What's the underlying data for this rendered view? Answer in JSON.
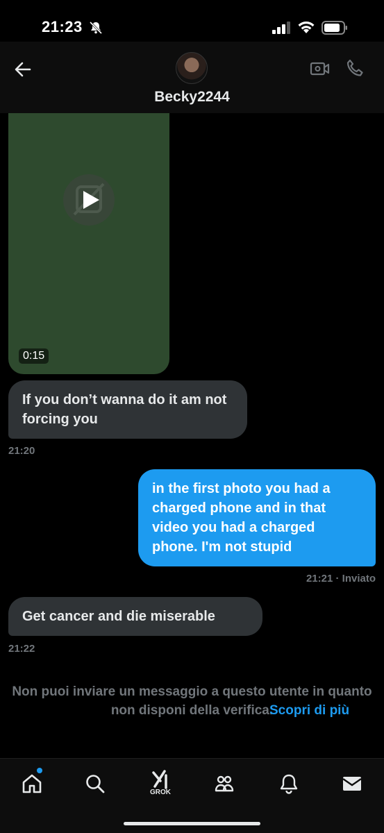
{
  "status_bar": {
    "time": "21:23"
  },
  "header": {
    "contact_name": "Becky2244"
  },
  "video_message": {
    "duration": "0:15"
  },
  "messages": [
    {
      "direction": "in",
      "text": "If you don’t wanna do it am not forcing you",
      "time": "21:20"
    },
    {
      "direction": "out",
      "text": "in the first photo you had a charged phone and in that video you had a charged phone. I'm not stupid",
      "time": "21:21 · Inviato"
    },
    {
      "direction": "in",
      "text": "Get cancer and die miserable",
      "time": "21:22"
    }
  ],
  "notice": {
    "text": "Non puoi inviare un messaggio a questo utente in quanto non disponi della verifica.",
    "link": "Scopri di più"
  },
  "tabbar": {
    "items": [
      {
        "icon": "home-icon"
      },
      {
        "icon": "search-icon"
      },
      {
        "icon": "grok-icon",
        "label": "GROK"
      },
      {
        "icon": "communities-icon"
      },
      {
        "icon": "bell-icon"
      },
      {
        "icon": "mail-icon"
      }
    ]
  },
  "colors": {
    "accent": "#1d9bf0",
    "bubble_in": "#2f3336",
    "muted": "#71767b",
    "video_bg": "#2e4a2e"
  }
}
